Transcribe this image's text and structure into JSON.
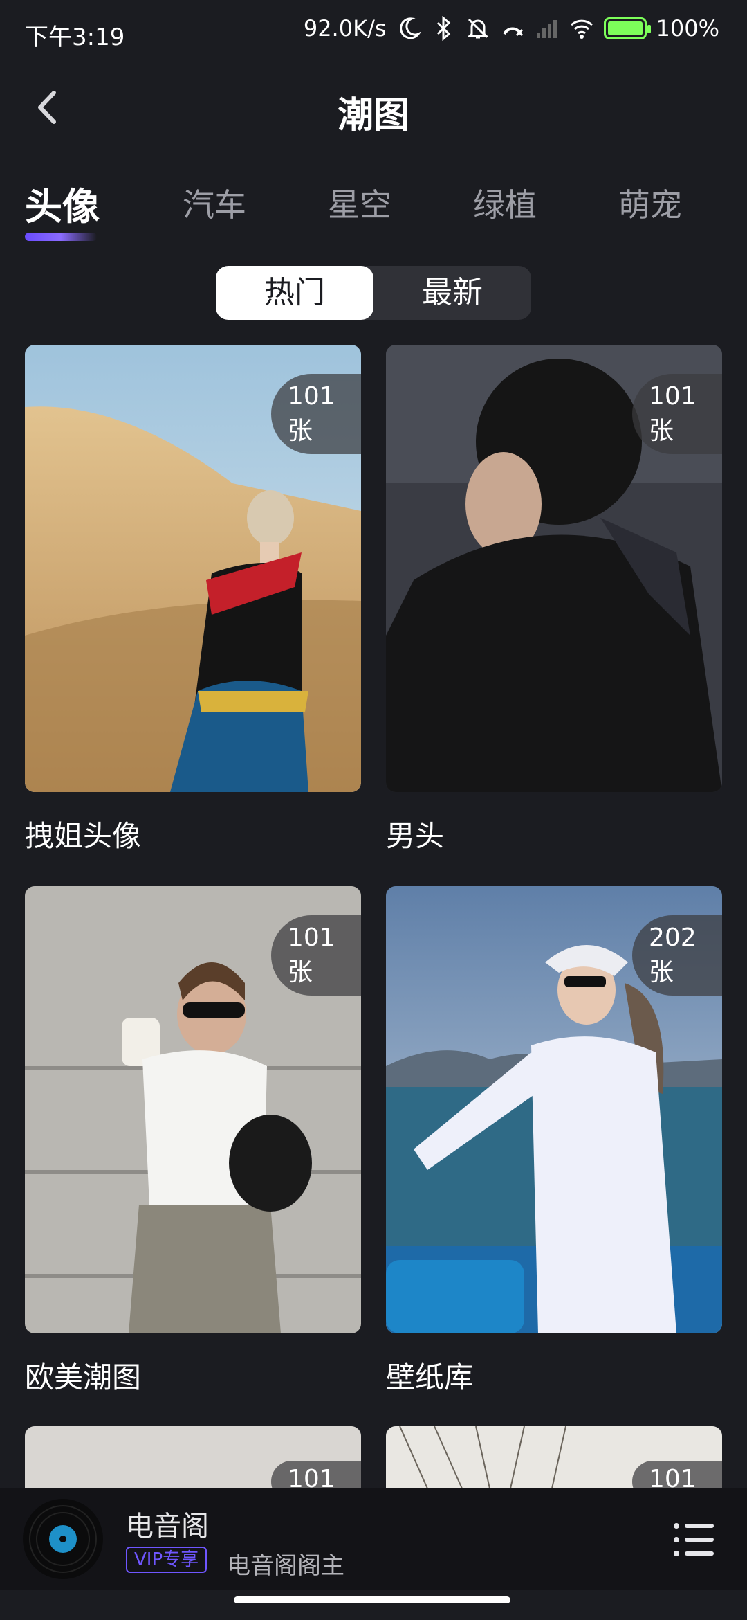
{
  "status_bar": {
    "time": "下午3:19",
    "net_speed": "92.0K/s",
    "battery": "100%",
    "battery_level": 1.0
  },
  "header": {
    "title": "潮图"
  },
  "tabs": [
    "头像",
    "汽车",
    "星空",
    "绿植",
    "萌宠"
  ],
  "active_tab": "头像",
  "sort_toggle": {
    "hot_label": "热门",
    "new_label": "最新",
    "selected": "热门"
  },
  "cards": [
    {
      "title": "拽姐头像",
      "count": "101",
      "unit": "张"
    },
    {
      "title": "男头",
      "count": "101",
      "unit": "张"
    },
    {
      "title": "欧美潮图",
      "count": "101",
      "unit": "张"
    },
    {
      "title": "壁纸库",
      "count": "202",
      "unit": "张"
    }
  ],
  "partial_cards": [
    {
      "count": "101"
    },
    {
      "count": "101"
    }
  ],
  "player": {
    "title": "电音阁",
    "badge": "VIP专享",
    "artist": "电音阁阁主"
  },
  "colors": {
    "background": "#1b1c21",
    "accent": "#6a4cff",
    "inactive_tab": "#9d9ea6"
  }
}
